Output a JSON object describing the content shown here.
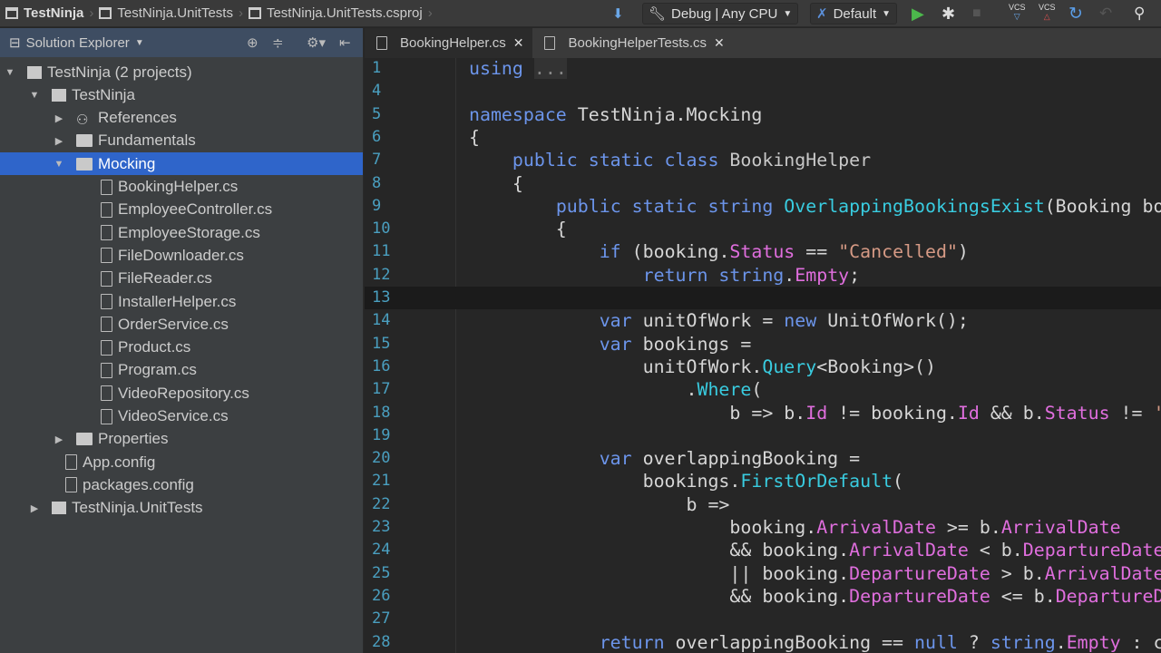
{
  "breadcrumb": [
    "TestNinja",
    "TestNinja.UnitTests",
    "TestNinja.UnitTests.csproj"
  ],
  "toolbar": {
    "config": "Debug | Any CPU",
    "target": "Default",
    "vcs1": "VCS",
    "vcs2": "VCS"
  },
  "sidebar": {
    "title": "Solution Explorer",
    "items": [
      {
        "label": "TestNinja (2 projects)",
        "level": 0,
        "arrow": "▼",
        "icon": "solution"
      },
      {
        "label": "TestNinja",
        "level": 1,
        "arrow": "▼",
        "icon": "project"
      },
      {
        "label": "References",
        "level": 2,
        "arrow": "▶",
        "icon": "references"
      },
      {
        "label": "Fundamentals",
        "level": 2,
        "arrow": "▶",
        "icon": "folder"
      },
      {
        "label": "Mocking",
        "level": 2,
        "arrow": "▼",
        "icon": "folder",
        "selected": true
      },
      {
        "label": "BookingHelper.cs",
        "level": 3,
        "icon": "file"
      },
      {
        "label": "EmployeeController.cs",
        "level": 3,
        "icon": "file"
      },
      {
        "label": "EmployeeStorage.cs",
        "level": 3,
        "icon": "file"
      },
      {
        "label": "FileDownloader.cs",
        "level": 3,
        "icon": "file"
      },
      {
        "label": "FileReader.cs",
        "level": 3,
        "icon": "file"
      },
      {
        "label": "InstallerHelper.cs",
        "level": 3,
        "icon": "file"
      },
      {
        "label": "OrderService.cs",
        "level": 3,
        "icon": "file"
      },
      {
        "label": "Product.cs",
        "level": 3,
        "icon": "file"
      },
      {
        "label": "Program.cs",
        "level": 3,
        "icon": "file"
      },
      {
        "label": "VideoRepository.cs",
        "level": 3,
        "icon": "file"
      },
      {
        "label": "VideoService.cs",
        "level": 3,
        "icon": "file"
      },
      {
        "label": "Properties",
        "level": 2,
        "arrow": "▶",
        "icon": "folder"
      },
      {
        "label": "App.config",
        "level": 2,
        "icon": "config"
      },
      {
        "label": "packages.config",
        "level": 2,
        "icon": "config"
      },
      {
        "label": "TestNinja.UnitTests",
        "level": 1,
        "arrow": "▶",
        "icon": "project"
      }
    ]
  },
  "tabs": [
    {
      "label": "BookingHelper.cs",
      "active": true,
      "close": "✕"
    },
    {
      "label": "BookingHelperTests.cs",
      "active": false,
      "close": "✕"
    }
  ],
  "code": [
    {
      "n": "1",
      "t": [
        [
          "using",
          "kw"
        ],
        [
          " ",
          ""
        ],
        [
          "...",
          "fold"
        ]
      ]
    },
    {
      "n": "4",
      "t": []
    },
    {
      "n": "5",
      "t": [
        [
          "namespace ",
          "kw"
        ],
        [
          "TestNinja.Mocking",
          "id"
        ]
      ]
    },
    {
      "n": "6",
      "t": [
        [
          "{",
          "id"
        ]
      ]
    },
    {
      "n": "7",
      "t": [
        [
          "    ",
          ""
        ],
        [
          "public static class ",
          "kw"
        ],
        [
          "BookingHelper",
          "cls"
        ]
      ]
    },
    {
      "n": "8",
      "t": [
        [
          "    {",
          "id"
        ]
      ]
    },
    {
      "n": "9",
      "t": [
        [
          "        ",
          ""
        ],
        [
          "public static string ",
          "kw"
        ],
        [
          "OverlappingBookingsExist",
          "mt"
        ],
        [
          "(Booking bo",
          "id"
        ]
      ]
    },
    {
      "n": "10",
      "t": [
        [
          "        {",
          "id"
        ]
      ]
    },
    {
      "n": "11",
      "t": [
        [
          "            ",
          ""
        ],
        [
          "if ",
          "kw"
        ],
        [
          "(booking.",
          "id"
        ],
        [
          "Status",
          "pr"
        ],
        [
          " == ",
          "id"
        ],
        [
          "\"Cancelled\"",
          "st"
        ],
        [
          ")",
          "id"
        ]
      ]
    },
    {
      "n": "12",
      "t": [
        [
          "                ",
          ""
        ],
        [
          "return string",
          "kw"
        ],
        [
          ".",
          "id"
        ],
        [
          "Empty",
          "pr"
        ],
        [
          ";",
          "id"
        ]
      ]
    },
    {
      "n": "13",
      "t": [],
      "current": true
    },
    {
      "n": "14",
      "t": [
        [
          "            ",
          ""
        ],
        [
          "var ",
          "kw"
        ],
        [
          "unitOfWork = ",
          "id"
        ],
        [
          "new ",
          "kw"
        ],
        [
          "UnitOfWork();",
          "id"
        ]
      ]
    },
    {
      "n": "15",
      "t": [
        [
          "            ",
          ""
        ],
        [
          "var ",
          "kw"
        ],
        [
          "bookings =",
          "id"
        ]
      ]
    },
    {
      "n": "16",
      "t": [
        [
          "                unitOfWork.",
          "id"
        ],
        [
          "Query",
          "mt"
        ],
        [
          "<Booking>()",
          "id"
        ]
      ]
    },
    {
      "n": "17",
      "t": [
        [
          "                    .",
          "id"
        ],
        [
          "Where",
          "mt"
        ],
        [
          "(",
          "id"
        ]
      ]
    },
    {
      "n": "18",
      "t": [
        [
          "                        b => b.",
          "id"
        ],
        [
          "Id",
          "pr"
        ],
        [
          " != booking.",
          "id"
        ],
        [
          "Id",
          "pr"
        ],
        [
          " && b.",
          "id"
        ],
        [
          "Status",
          "pr"
        ],
        [
          " != ",
          "id"
        ],
        [
          "'",
          "st"
        ]
      ]
    },
    {
      "n": "19",
      "t": []
    },
    {
      "n": "20",
      "t": [
        [
          "            ",
          ""
        ],
        [
          "var ",
          "kw"
        ],
        [
          "overlappingBooking =",
          "id"
        ]
      ]
    },
    {
      "n": "21",
      "t": [
        [
          "                bookings.",
          "id"
        ],
        [
          "FirstOrDefault",
          "mt"
        ],
        [
          "(",
          "id"
        ]
      ]
    },
    {
      "n": "22",
      "t": [
        [
          "                    b =>",
          "id"
        ]
      ]
    },
    {
      "n": "23",
      "t": [
        [
          "                        booking.",
          "id"
        ],
        [
          "ArrivalDate",
          "pr"
        ],
        [
          " >= b.",
          "id"
        ],
        [
          "ArrivalDate",
          "pr"
        ]
      ]
    },
    {
      "n": "24",
      "t": [
        [
          "                        && booking.",
          "id"
        ],
        [
          "ArrivalDate",
          "pr"
        ],
        [
          " < b.",
          "id"
        ],
        [
          "DepartureDate",
          "pr"
        ]
      ]
    },
    {
      "n": "25",
      "t": [
        [
          "                        || booking.",
          "id"
        ],
        [
          "DepartureDate",
          "pr"
        ],
        [
          " > b.",
          "id"
        ],
        [
          "ArrivalDate",
          "pr"
        ]
      ]
    },
    {
      "n": "26",
      "t": [
        [
          "                        && booking.",
          "id"
        ],
        [
          "DepartureDate",
          "pr"
        ],
        [
          " <= b.",
          "id"
        ],
        [
          "DepartureD",
          "pr"
        ]
      ]
    },
    {
      "n": "27",
      "t": []
    },
    {
      "n": "28",
      "t": [
        [
          "            ",
          ""
        ],
        [
          "return ",
          "kw"
        ],
        [
          "overlappingBooking == ",
          "id"
        ],
        [
          "null",
          "kw"
        ],
        [
          " ? ",
          "id"
        ],
        [
          "string",
          "kw"
        ],
        [
          ".",
          "id"
        ],
        [
          "Empty",
          "pr"
        ],
        [
          " : c",
          "id"
        ]
      ]
    }
  ]
}
